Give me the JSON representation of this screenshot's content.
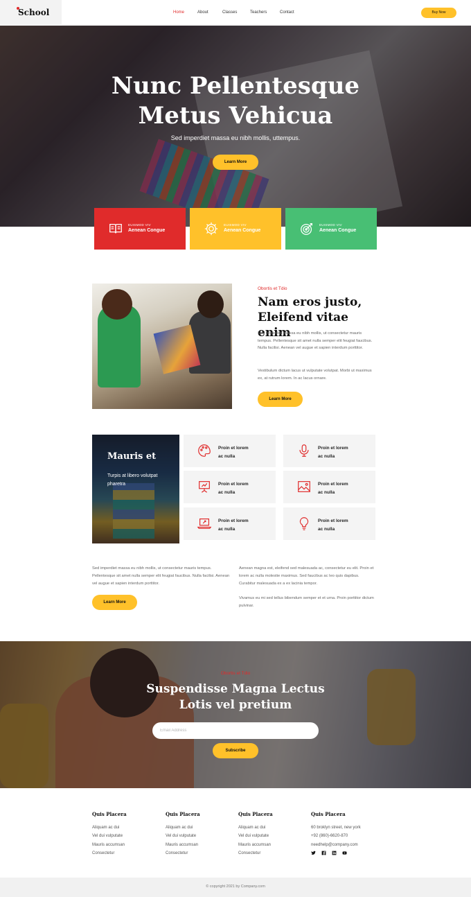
{
  "header": {
    "logo": "School",
    "nav": [
      "Home",
      "About",
      "Classes",
      "Teachers",
      "Contact"
    ],
    "buy_label": "Buy Now"
  },
  "hero": {
    "title_line1": "Nunc Pellentesque",
    "title_line2": "Metus Vehicua",
    "subtitle": "Sed imperdiet massa eu nibh mollis, uttempus.",
    "button": "Learn More"
  },
  "features": [
    {
      "kicker": "EUISMOD VIV",
      "title": "Aenean Congue",
      "icon": "book-icon",
      "color": "#e02b2b"
    },
    {
      "kicker": "EUISMOD VIV",
      "title": "Aenean Congue",
      "icon": "gear-icon",
      "color": "#ffc12a"
    },
    {
      "kicker": "EUISMOD VIV",
      "title": "Aenean Congue",
      "icon": "target-icon",
      "color": "#48bf74"
    }
  ],
  "about": {
    "kicker": "Obortis et Tdio",
    "title_line1": "Nam eros justo,",
    "title_line2": "Eleifend vitae enim",
    "paragraph1": "Sed imperdiet massa eu nibh mollis, ut consectetur mauris tempus. Pellentesque sit amet nulla semper elit feugiat faucibus. Nulla facilisi. Aenean vel augue et sapien interdum porttitor.",
    "paragraph2": "Vestibulum dictum lacus ut vulputate volutpat. Morbi ut maximus ex, at rutrum lorem. In ac lacus ornare.",
    "button": "Learn More"
  },
  "services": {
    "feature_title": "Mauris et",
    "feature_text": "Turpis at libero volutpat pharetra",
    "tiles": [
      {
        "label_line1": "Proin et lorem",
        "label_line2": "ac nulla",
        "icon": "palette-icon"
      },
      {
        "label_line1": "Proin et lorem",
        "label_line2": "ac nulla",
        "icon": "microphone-icon"
      },
      {
        "label_line1": "Proin et lorem",
        "label_line2": "ac nulla",
        "icon": "presentation-icon"
      },
      {
        "label_line1": "Proin et lorem",
        "label_line2": "ac nulla",
        "icon": "picture-icon"
      },
      {
        "label_line1": "Proin et lorem",
        "label_line2": "ac nulla",
        "icon": "laptop-icon"
      },
      {
        "label_line1": "Proin et lorem",
        "label_line2": "ac nulla",
        "icon": "lightbulb-icon"
      }
    ]
  },
  "text_columns": {
    "left": "Sed imperdiet massa eu nibh mollis, ut consectetur mauris tempus. Pellentesque sit amet nulla semper elit feugiat faucibus. Nulla facilisi. Aenean vel augue et sapien interdum porttitor.",
    "left_button": "Learn More",
    "right1": "Aenean magna est, eleifend sed malesuada ac, consectetur eu elit. Proin et lorem ac nulla molestie maximus. Sed faucibus ac leo quis dapibus. Curabitur malesuada ex a ex lacinia tempor.",
    "right2": "Vivamus eu mi sed tellus bibendum semper et et urna. Proin porttitor dictum pulvinar."
  },
  "newsletter": {
    "kicker": "Obortis et Tdio",
    "title_line1": "Suspendisse Magna Lectus",
    "title_line2": "Lotis vel pretium",
    "email_placeholder": "Email Address",
    "button": "Subscribe"
  },
  "footer": {
    "columns": [
      {
        "title": "Quis Placera",
        "items": [
          "Aliquam ac dui",
          "Vel dui vulputate",
          "Mauris accumsan",
          "Consectetur"
        ]
      },
      {
        "title": "Quis Placera",
        "items": [
          "Aliquam ac dui",
          "Vel dui vulputate",
          "Mauris accumsan",
          "Consectetur"
        ]
      },
      {
        "title": "Quis Placera",
        "items": [
          "Aliquam ac dui",
          "Vel dui vulputate",
          "Mauris accumsan",
          "Consectetur"
        ]
      },
      {
        "title": "Quis Placera",
        "items": [
          "60 broklyn street, new york",
          "+92 (860)-6620-870",
          "needhelp@company.com"
        ]
      }
    ],
    "socials": [
      "twitter-icon",
      "facebook-icon",
      "linkedin-icon",
      "youtube-icon"
    ],
    "copyright": "© copyright 2021 by Company.com"
  },
  "colors": {
    "accent_yellow": "#ffc12a",
    "accent_red": "#e02b2b",
    "accent_green": "#48bf74"
  }
}
